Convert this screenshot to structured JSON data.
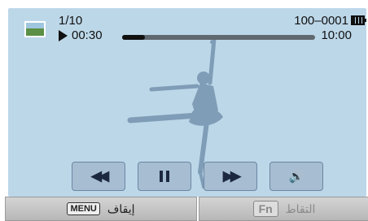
{
  "status": {
    "counter": "1/10",
    "elapsed": "00:30",
    "duration": "10:00",
    "file_number": "100–0001",
    "progress_fraction": 0.12,
    "play_icon": "play-icon",
    "battery_icon": "battery-full-icon",
    "thumbnail_icon": "landscape-thumbnail-icon"
  },
  "controls": [
    {
      "name": "rewind",
      "symbol": "◀◀",
      "icon": "rewind-icon"
    },
    {
      "name": "pause",
      "icon": "pause-icon"
    },
    {
      "name": "forward",
      "symbol": "▶▶",
      "icon": "fast-forward-icon"
    },
    {
      "name": "volume",
      "symbol": "🔊",
      "icon": "volume-icon"
    }
  ],
  "softkeys": {
    "stop": {
      "key": "MENU",
      "label": "إيقاف"
    },
    "capture": {
      "key": "Fn",
      "label": "التقاط"
    }
  },
  "colors": {
    "background": "#bcd7e8",
    "dancer": "#7f9db7",
    "button": "#a7bdd2"
  }
}
